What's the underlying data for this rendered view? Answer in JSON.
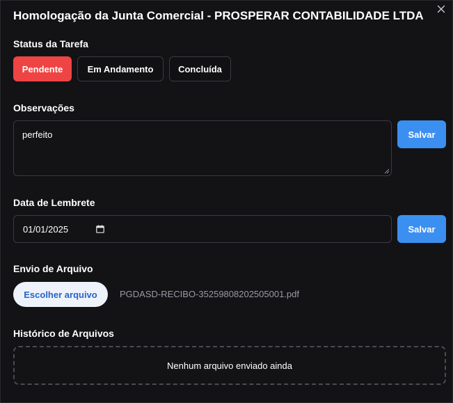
{
  "modal": {
    "title": "Homologação da Junta Comercial - PROSPERAR CONTABILIDADE LTDA",
    "close_icon": "close-icon"
  },
  "status": {
    "label": "Status da Tarefa",
    "options": [
      {
        "label": "Pendente",
        "selected": true
      },
      {
        "label": "Em Andamento",
        "selected": false
      },
      {
        "label": "Concluída",
        "selected": false
      }
    ]
  },
  "observations": {
    "label": "Observações",
    "value": "perfeito",
    "save_label": "Salvar"
  },
  "reminder": {
    "label": "Data de Lembrete",
    "value": "01/01/2025",
    "save_label": "Salvar",
    "icon": "calendar-icon"
  },
  "upload": {
    "label": "Envio de Arquivo",
    "button_label": "Escolher arquivo",
    "file_name": "PGDASD-RECIBO-35259808202505001.pdf"
  },
  "history": {
    "label": "Histórico de Arquivos",
    "empty_text": "Nenhum arquivo enviado ainda"
  },
  "colors": {
    "background": "#131316",
    "active_status": "#ef4444",
    "save_button": "#3b8ff0",
    "file_button_bg": "#eef3fb",
    "file_button_text": "#2563c9"
  }
}
